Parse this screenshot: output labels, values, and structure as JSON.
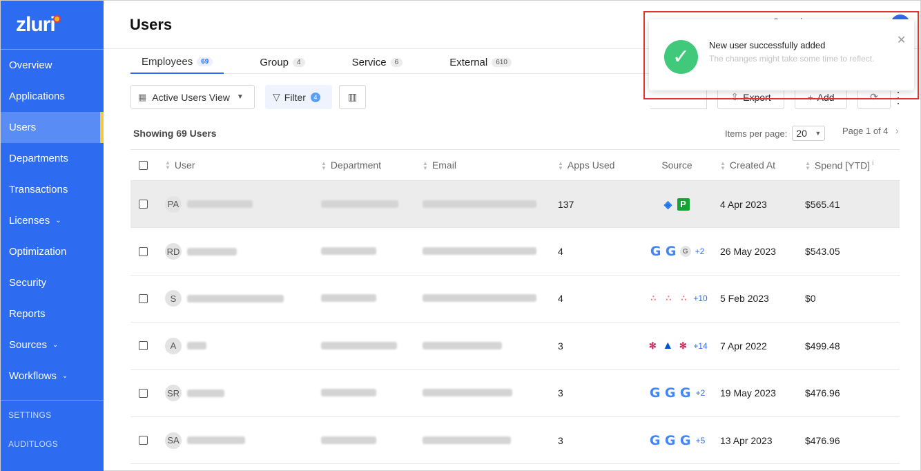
{
  "app": {
    "logo": "zluri"
  },
  "sidebar": {
    "items": [
      {
        "label": "Overview"
      },
      {
        "label": "Applications"
      },
      {
        "label": "Users",
        "active": true
      },
      {
        "label": "Departments"
      },
      {
        "label": "Transactions"
      },
      {
        "label": "Licenses",
        "chevron": "chevron-down-icon"
      },
      {
        "label": "Optimization"
      },
      {
        "label": "Security"
      },
      {
        "label": "Reports"
      },
      {
        "label": "Sources",
        "chevron": "chevron-down-icon"
      },
      {
        "label": "Workflows",
        "chevron": "chevron-down-icon"
      }
    ],
    "footer": [
      "SETTINGS",
      "AUDITLOGS"
    ]
  },
  "header": {
    "title": "Users"
  },
  "tabs": [
    {
      "label": "Employees",
      "count": "69",
      "active": true
    },
    {
      "label": "Group",
      "count": "4"
    },
    {
      "label": "Service",
      "count": "6"
    },
    {
      "label": "External",
      "count": "610"
    }
  ],
  "toolbar": {
    "view_label": "Active Users View",
    "filter_label": "Filter",
    "filter_count": "4",
    "export_label": "Export",
    "add_label": "Add"
  },
  "listing": {
    "showing": "Showing 69 Users",
    "items_per_page_label": "Items per page:",
    "items_per_page": "20",
    "page_info": "Page 1 of 4"
  },
  "table": {
    "headers": {
      "user": "User",
      "department": "Department",
      "email": "Email",
      "apps_used": "Apps Used",
      "source": "Source",
      "created_at": "Created At",
      "spend": "Spend [YTD]"
    },
    "rows": [
      {
        "initials": "PA",
        "apps": "137",
        "source_icons": [
          "azure-ad-icon",
          "p-app-icon"
        ],
        "source_more": "",
        "created": "4 Apr 2023",
        "spend": "$565.41",
        "highlight": true
      },
      {
        "initials": "RD",
        "apps": "4",
        "source_icons": [
          "google-icon",
          "google-icon",
          "g-avatar-icon"
        ],
        "source_more": "+2",
        "created": "26 May 2023",
        "spend": "$543.05"
      },
      {
        "initials": "S",
        "apps": "4",
        "source_icons": [
          "asana-icon",
          "asana-icon",
          "asana-icon"
        ],
        "source_more": "+10",
        "created": "5 Feb 2023",
        "spend": "$0"
      },
      {
        "initials": "A",
        "apps": "3",
        "source_icons": [
          "slack-icon",
          "atlassian-icon",
          "slack-icon"
        ],
        "source_more": "+14",
        "created": "7 Apr 2022",
        "spend": "$499.48"
      },
      {
        "initials": "SR",
        "apps": "3",
        "source_icons": [
          "google-icon",
          "google-icon",
          "google-icon"
        ],
        "source_more": "+2",
        "created": "19 May 2023",
        "spend": "$476.96"
      },
      {
        "initials": "SA",
        "apps": "3",
        "source_icons": [
          "google-icon",
          "google-icon",
          "google-icon"
        ],
        "source_more": "+5",
        "created": "13 Apr 2023",
        "spend": "$476.96"
      }
    ]
  },
  "toast": {
    "title": "New user successfully added",
    "subtitle": "The changes might take some time to reflect."
  },
  "colors": {
    "brand": "#2d6bf0",
    "success": "#40c97a",
    "highlight_frame": "#e53030"
  }
}
